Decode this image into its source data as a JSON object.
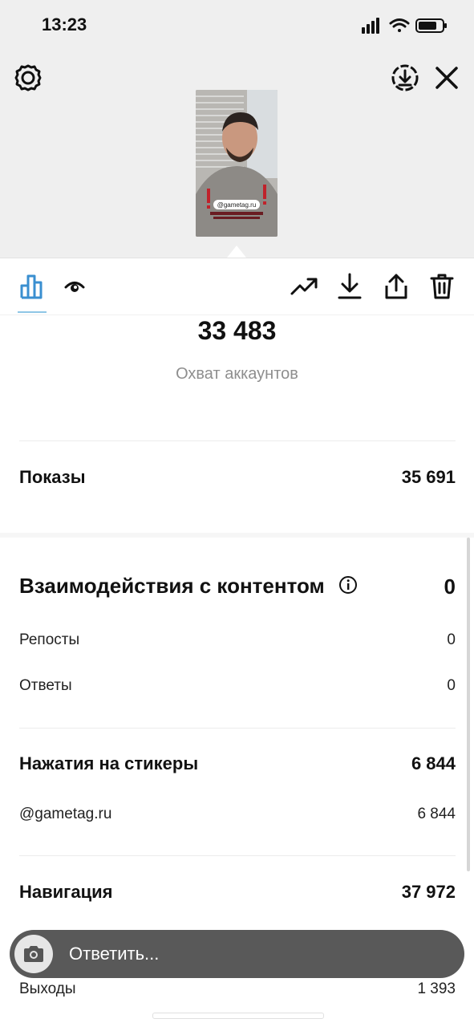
{
  "status_bar": {
    "time": "13:23"
  },
  "thumbnail": {
    "sticker_text": "@gametag.ru"
  },
  "metrics": {
    "reach_value": "33 483",
    "reach_label": "Охват аккаунтов",
    "impressions_label": "Показы",
    "impressions_value": "35 691"
  },
  "interactions": {
    "title": "Взаимодействия с контентом",
    "value": "0",
    "rows": [
      {
        "label": "Репосты",
        "value": "0"
      },
      {
        "label": "Ответы",
        "value": "0"
      }
    ]
  },
  "sticker_taps": {
    "title": "Нажатия на стикеры",
    "value": "6 844",
    "rows": [
      {
        "label": "@gametag.ru",
        "value": "6 844"
      }
    ]
  },
  "navigation": {
    "title": "Навигация",
    "value": "37 972",
    "rows": [
      {
        "label": "Выходы",
        "value": "1 393"
      }
    ]
  },
  "reply": {
    "placeholder": "Ответить..."
  },
  "colors": {
    "accent": "#3897f0",
    "tab_underline": "#8fc6e6",
    "reply_bar": "#595959"
  }
}
